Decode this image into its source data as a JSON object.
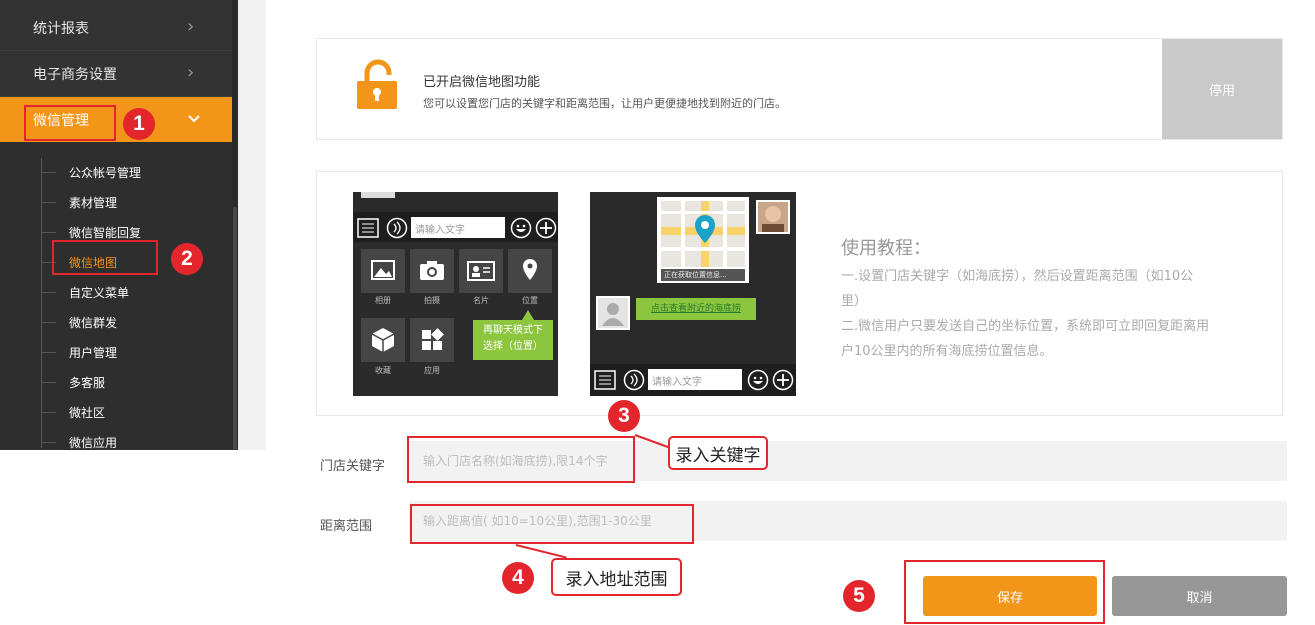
{
  "sidebar": {
    "items": [
      {
        "label": "统计报表"
      },
      {
        "label": "电子商务设置"
      },
      {
        "label": "微信管理"
      }
    ],
    "sub_items": [
      {
        "label": "公众帐号管理"
      },
      {
        "label": "素材管理"
      },
      {
        "label": "微信智能回复"
      },
      {
        "label": "微信地图"
      },
      {
        "label": "自定义菜单"
      },
      {
        "label": "微信群发"
      },
      {
        "label": "用户管理"
      },
      {
        "label": "多客服"
      },
      {
        "label": "微社区"
      },
      {
        "label": "微信应用"
      }
    ],
    "accent_color": "#f39519"
  },
  "status": {
    "title": "已开启微信地图功能",
    "description": "您可以设置您门店的关键字和距离范围，让用户更便捷地找到附近的门店。",
    "disable_label": "停用",
    "icon": "lock-open-icon"
  },
  "tutorial": {
    "title": "使用教程：",
    "steps": [
      "一.设置门店关键字（如海底捞），然后设置距离范围（如10公",
      "里）",
      "二.微信用户只要发送自己的坐标位置，系统即可立即回复距离用",
      "户10公里内的所有海底捞位置信息。"
    ],
    "phone1": {
      "input_placeholder": "请输入文字",
      "apps": [
        "相册",
        "拍摄",
        "名片",
        "位置",
        "收藏",
        "应用"
      ],
      "tip": "再聊天模式下选择（位置）"
    },
    "phone2": {
      "map_caption": "正在获取位置信息...",
      "bubble": "点击查看附近的海底捞",
      "input_placeholder": "请输入文字"
    }
  },
  "form": {
    "keyword_label": "门店关键字",
    "keyword_placeholder": "输入门店名称(如海底捞),限14个字",
    "range_label": "距离范围",
    "range_placeholder": "输入距离值( 如10=10公里),范围1-30公里",
    "save_label": "保存",
    "cancel_label": "取消"
  },
  "annotations": {
    "steps": [
      "1",
      "2",
      "3",
      "4",
      "5"
    ],
    "keyword_callout": "录入关键字",
    "range_callout": "录入地址范围"
  }
}
